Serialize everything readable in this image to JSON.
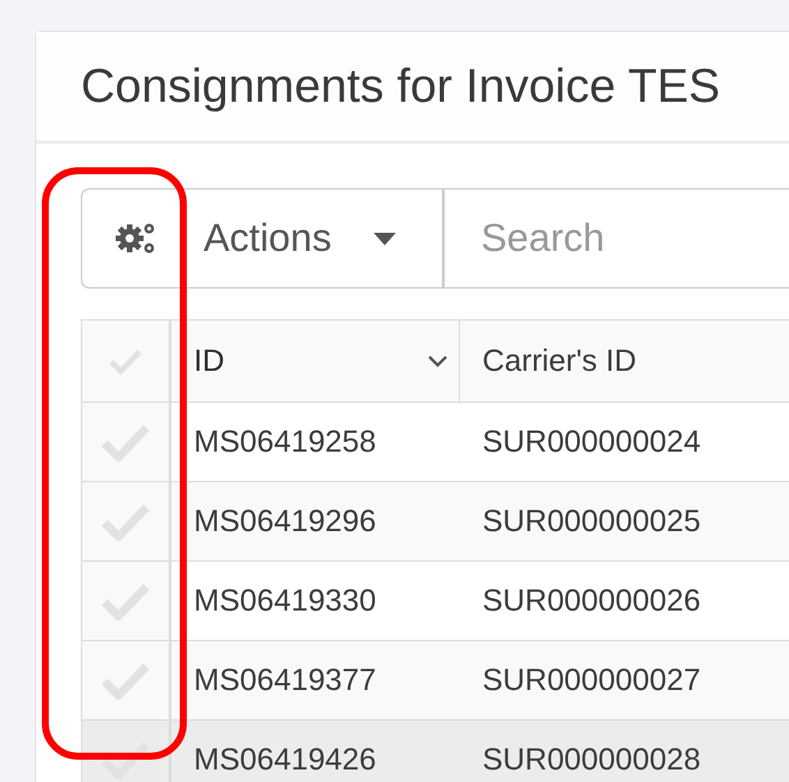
{
  "panel": {
    "title": "Consignments for Invoice TES"
  },
  "toolbar": {
    "settings_button": {
      "kind": "gear"
    },
    "actions_button": {
      "label": "Actions"
    },
    "search": {
      "placeholder": "Search"
    }
  },
  "table": {
    "select_all": {
      "checked": false
    },
    "columns": [
      {
        "label": "ID",
        "sorted": true
      },
      {
        "label": "Carrier's ID",
        "sorted": false
      }
    ],
    "rows": [
      {
        "checked": false,
        "hovered": false,
        "cells": [
          "MS06419258",
          "SUR000000024"
        ]
      },
      {
        "checked": false,
        "hovered": false,
        "cells": [
          "MS06419296",
          "SUR000000025"
        ]
      },
      {
        "checked": false,
        "hovered": false,
        "cells": [
          "MS06419330",
          "SUR000000026"
        ]
      },
      {
        "checked": false,
        "hovered": false,
        "cells": [
          "MS06419377",
          "SUR000000027"
        ]
      },
      {
        "checked": false,
        "hovered": true,
        "cells": [
          "MS06419426",
          "SUR000000028"
        ]
      }
    ]
  },
  "annotation": {
    "kind": "highlight"
  }
}
